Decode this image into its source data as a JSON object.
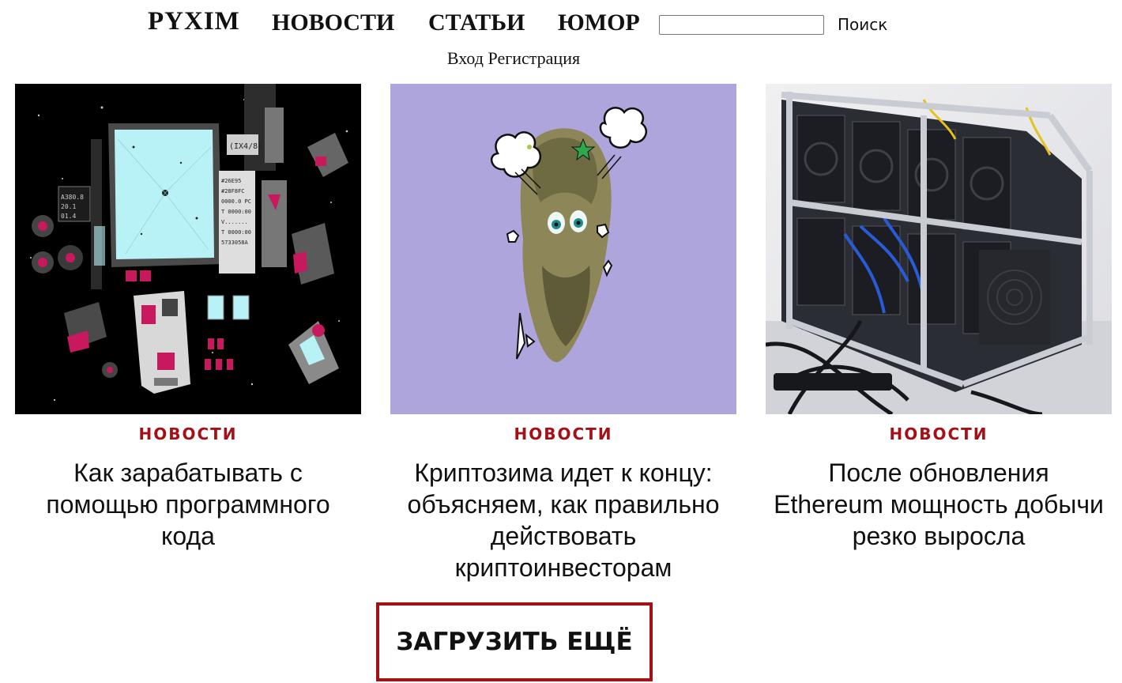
{
  "header": {
    "logo": "PYXIM",
    "nav": [
      "НОВОСТИ",
      "СТАТЬИ",
      "ЮМОР"
    ],
    "search": {
      "value": "",
      "placeholder": "",
      "button_label": "Поиск"
    },
    "auth": {
      "login": "Вход",
      "register": "Регистрация"
    }
  },
  "cards": [
    {
      "category": "НОВОСТИ",
      "title": "Как зарабатывать с помощью программного кода",
      "image": "retro-computer-isometric-illustration",
      "screen_readout": [
        "(IX4/8)",
        "#26E95",
        "#28F8FC",
        "0000.0 PC",
        "T 0000:00",
        "V.......",
        "T 0000:00",
        "5733058A"
      ]
    },
    {
      "category": "НОВОСТИ",
      "title": "Криптозима идет к концу: объясняем, как правильно действовать криптоинвесторам",
      "image": "surprised-statue-head-on-lavender"
    },
    {
      "category": "НОВОСТИ",
      "title": "После обновления Ethereum мощность добычи резко выросла",
      "image": "gpu-mining-rig-photo"
    }
  ],
  "load_more_label": "ЗАГРУЗИТЬ ЕЩЁ",
  "colors": {
    "accent": "#a50f16",
    "lavender": "#aea5dd",
    "screen": "#b9f2f6",
    "magenta": "#c8185e"
  }
}
